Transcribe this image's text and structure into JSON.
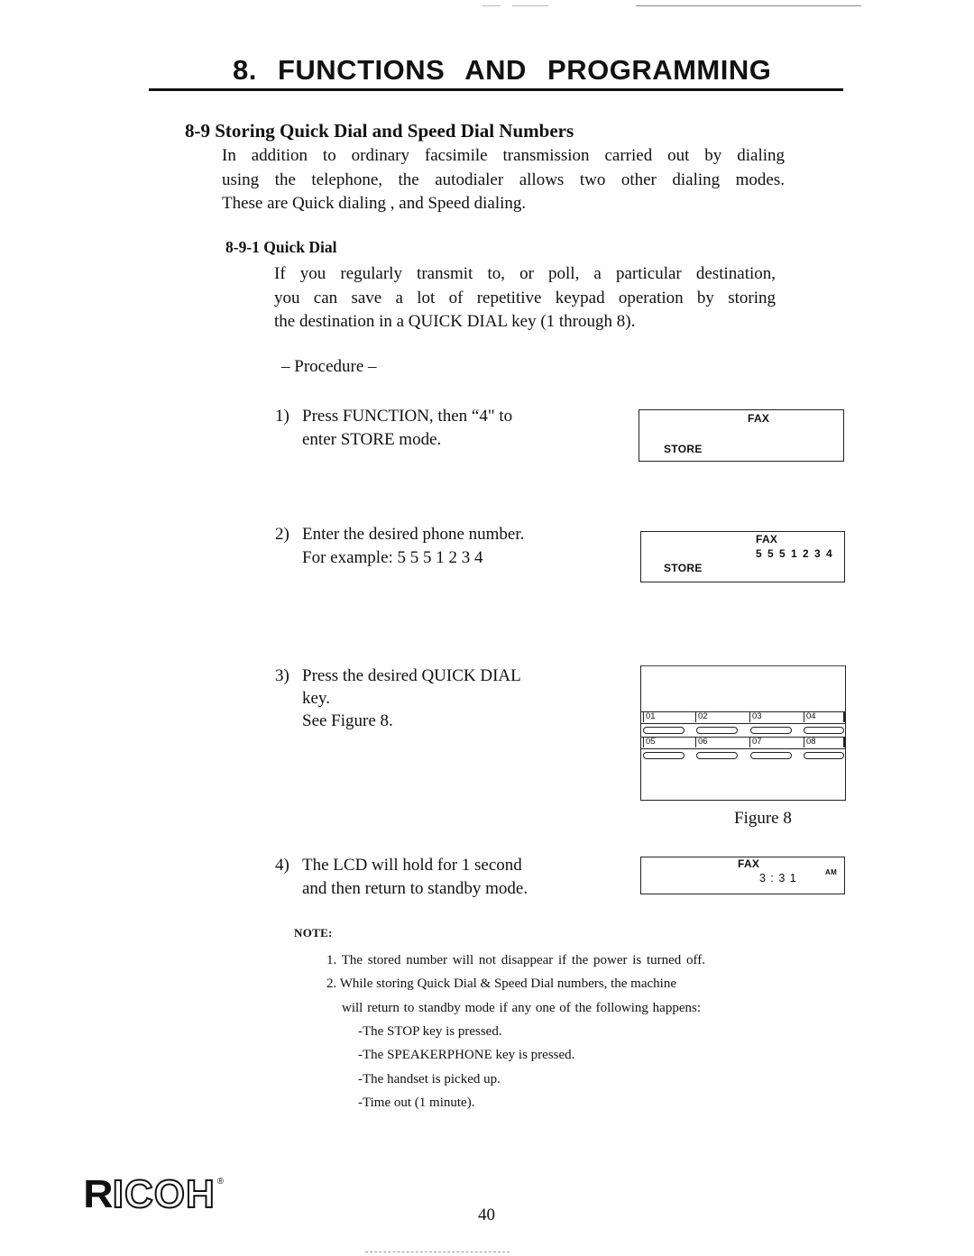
{
  "chapter": {
    "title": "8. FUNCTIONS AND PROGRAMMING"
  },
  "section": {
    "title": "8-9 Storing Quick Dial and Speed Dial Numbers",
    "intro_lines": [
      "In addition to ordinary facsimile transmission carried out by dialing",
      "using the telephone, the autodialer allows two other dialing modes.",
      "These are  Quick dialing , and Speed dialing."
    ]
  },
  "subsection": {
    "title": "8-9-1 Quick Dial",
    "lines": [
      "If you regularly transmit to, or poll, a particular destination,",
      "you can save a lot of repetitive keypad operation by storing",
      "the destination in a  QUICK DIAL key (1 through 8)."
    ],
    "procedure_label": "–  Procedure  –"
  },
  "steps": [
    {
      "num": "1)",
      "lines": [
        "Press  FUNCTION, then “4\" to",
        "enter STORE mode."
      ]
    },
    {
      "num": "2)",
      "lines": [
        "Enter the desired phone number.",
        "For example: 5 5 5 1 2 3 4"
      ]
    },
    {
      "num": "3)",
      "lines": [
        "Press the desired QUICK DIAL",
        "key.",
        "See Figure  8."
      ]
    },
    {
      "num": "4)",
      "lines": [
        "The LCD will hold for 1 second",
        "and then return to standby mode."
      ]
    }
  ],
  "lcd_displays": [
    {
      "top": "FAX",
      "middle": "",
      "bottom": "STORE"
    },
    {
      "top": "FAX",
      "middle": "5 5 5 1 2 3 4",
      "bottom": "STORE"
    },
    {
      "top": "FAX",
      "middle": "3 : 3 1",
      "suffix": "AM",
      "bottom": ""
    }
  ],
  "figure": {
    "caption": "Figure  8",
    "quick_dial_keys": [
      "01",
      "02",
      "03",
      "04",
      "05",
      "06",
      "07",
      "08"
    ]
  },
  "note": {
    "label": "NOTE:",
    "items": [
      "1. The stored number will not disappear if the power is turned off.",
      "2. While storing Quick Dial & Speed Dial numbers, the machine",
      "will return to standby mode if any one of the following happens:",
      "-The STOP key is pressed.",
      "-The SPEAKERPHONE key is pressed.",
      "-The handset is picked up.",
      "-Time out (1 minute)."
    ]
  },
  "footer": {
    "logo_solid": "R",
    "logo_outline": "ICOH",
    "logo_mark": "®",
    "page_number": "40"
  }
}
